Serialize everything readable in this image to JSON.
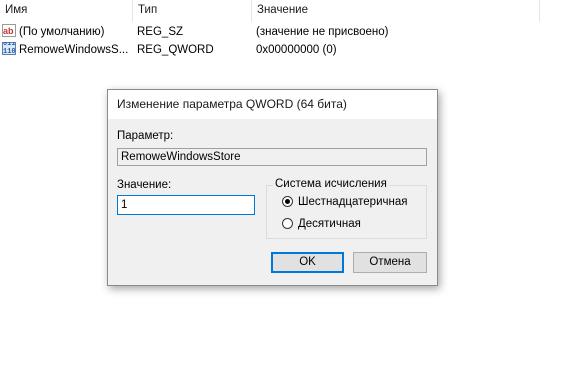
{
  "list": {
    "columns": [
      "Имя",
      "Тип",
      "Значение"
    ],
    "rows": [
      {
        "icon": "string-value-icon",
        "icon_text": "ab",
        "name": "(По умолчанию)",
        "type": "REG_SZ",
        "data": "(значение не присвоено)"
      },
      {
        "icon": "binary-value-icon",
        "icon_text": "011\n110",
        "name": "RemoweWindowsS...",
        "type": "REG_QWORD",
        "data": "0x00000000 (0)"
      }
    ]
  },
  "dialog": {
    "title": "Изменение параметра QWORD (64 бита)",
    "param_label": "Параметр:",
    "param_value": "RemoweWindowsStore",
    "value_label": "Значение:",
    "value_input": "1",
    "base_group_label": "Система исчисления",
    "base_options": [
      {
        "label": "Шестнадцатеричная",
        "checked": true
      },
      {
        "label": "Десятичная",
        "checked": false
      }
    ],
    "ok_label": "OK",
    "cancel_label": "Отмена"
  }
}
